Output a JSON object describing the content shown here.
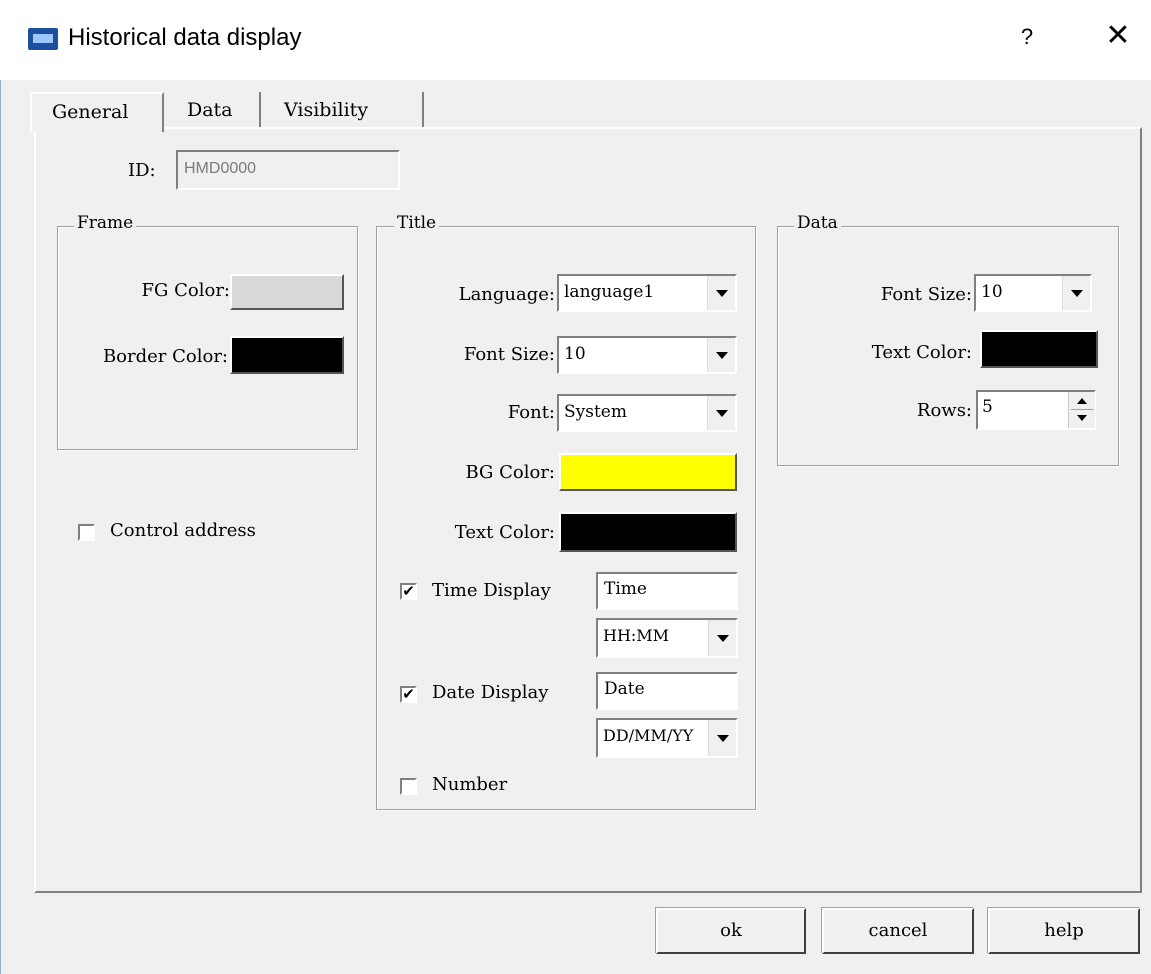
{
  "window": {
    "title": "Historical data display",
    "help": "?",
    "close": "✕"
  },
  "tabs": [
    "General",
    "Data",
    "Visibility"
  ],
  "general": {
    "id_label": "ID:",
    "id_value": "HMD0000",
    "frame": {
      "title": "Frame",
      "fg_color_label": "FG Color:",
      "fg_color": "#d9d9d9",
      "border_color_label": "Border Color:",
      "border_color": "#000000"
    },
    "control_address_label": "Control address",
    "title_group": {
      "title": "Title",
      "language_label": "Language:",
      "language_value": "language1",
      "font_size_label": "Font Size:",
      "font_size_value": "10",
      "font_label": "Font:",
      "font_value": "System",
      "bg_color_label": "BG Color:",
      "bg_color": "#ffff00",
      "text_color_label": "Text Color:",
      "text_color": "#000000",
      "time_display_label": "Time Display",
      "time_display_checked": true,
      "time_text": "Time",
      "time_format": "HH:MM",
      "date_display_label": "Date Display",
      "date_display_checked": true,
      "date_text": "Date",
      "date_format": "DD/MM/YY",
      "number_label": "Number",
      "number_checked": false
    },
    "data_group": {
      "title": "Data",
      "font_size_label": "Font Size:",
      "font_size_value": "10",
      "text_color_label": "Text Color:",
      "text_color": "#000000",
      "rows_label": "Rows:",
      "rows_value": "5"
    }
  },
  "buttons": {
    "ok": "ok",
    "cancel": "cancel",
    "help": "help"
  }
}
